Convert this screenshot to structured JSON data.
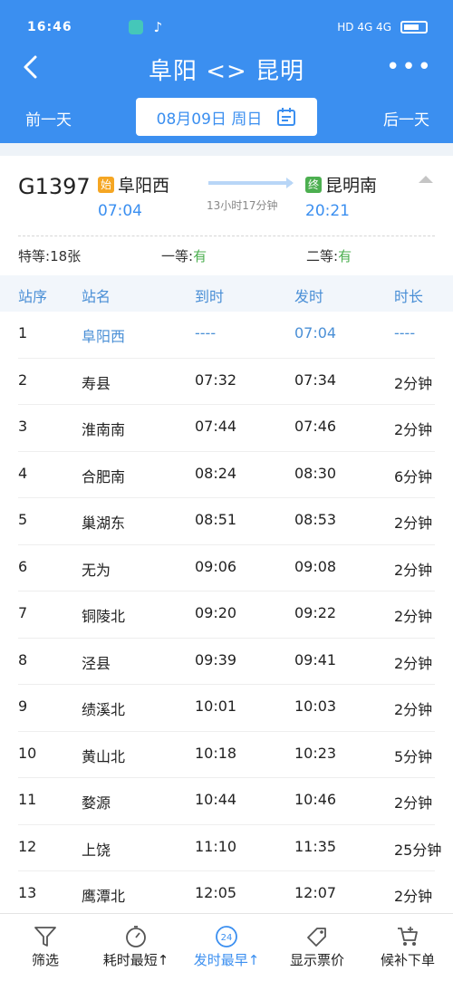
{
  "status_bar": {
    "time": "16:46",
    "network": "HD 4G 4G"
  },
  "header": {
    "title": "阜阳 <> 昆明",
    "prev_day": "前一天",
    "next_day": "后一天",
    "date": "08月09日 周日"
  },
  "train": {
    "number": "G1397",
    "from_tag": "始",
    "from_station": "阜阳西",
    "from_time": "07:04",
    "to_tag": "终",
    "to_station": "昆明南",
    "to_time": "20:21",
    "duration": "13小时17分钟"
  },
  "seats": {
    "business_label": "特等:",
    "business_value": "18张",
    "first_label": "一等:",
    "first_value": "有",
    "second_label": "二等:",
    "second_value": "有"
  },
  "table": {
    "headers": [
      "站序",
      "站名",
      "到时",
      "发时",
      "时长"
    ],
    "rows": [
      [
        "1",
        "阜阳西",
        "----",
        "07:04",
        "----"
      ],
      [
        "2",
        "寿县",
        "07:32",
        "07:34",
        "2分钟"
      ],
      [
        "3",
        "淮南南",
        "07:44",
        "07:46",
        "2分钟"
      ],
      [
        "4",
        "合肥南",
        "08:24",
        "08:30",
        "6分钟"
      ],
      [
        "5",
        "巢湖东",
        "08:51",
        "08:53",
        "2分钟"
      ],
      [
        "6",
        "无为",
        "09:06",
        "09:08",
        "2分钟"
      ],
      [
        "7",
        "铜陵北",
        "09:20",
        "09:22",
        "2分钟"
      ],
      [
        "8",
        "泾县",
        "09:39",
        "09:41",
        "2分钟"
      ],
      [
        "9",
        "绩溪北",
        "10:01",
        "10:03",
        "2分钟"
      ],
      [
        "10",
        "黄山北",
        "10:18",
        "10:23",
        "5分钟"
      ],
      [
        "11",
        "婺源",
        "10:44",
        "10:46",
        "2分钟"
      ],
      [
        "12",
        "上饶",
        "11:10",
        "11:35",
        "25分钟"
      ],
      [
        "13",
        "鹰潭北",
        "12:05",
        "12:07",
        "2分钟"
      ]
    ]
  },
  "bottom_bar": {
    "filter": "筛选",
    "shortest": "耗时最短↑",
    "departure_icon_text": "24",
    "earliest": "发时最早↑",
    "show_price": "显示票价",
    "waitlist": "候补下单"
  },
  "colors": {
    "primary": "#3b8ff0",
    "green": "#4caf50",
    "orange": "#f5a623"
  }
}
